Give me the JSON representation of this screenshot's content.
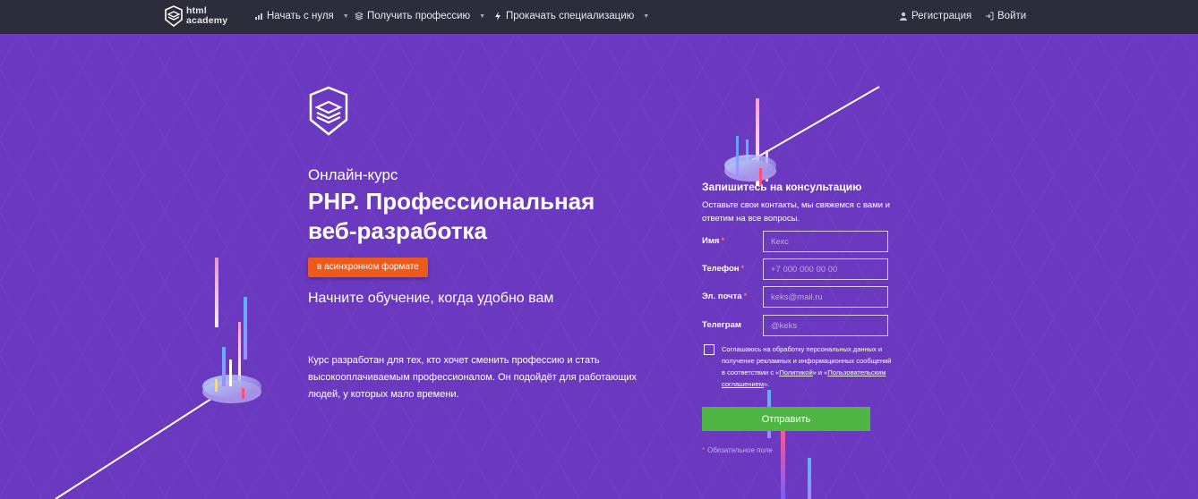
{
  "nav": {
    "logo_line1": "html",
    "logo_line2": "academy",
    "items": [
      {
        "label": "Начать с нуля",
        "icon": "bar-chart-icon"
      },
      {
        "label": "Получить профессию",
        "icon": "stack-icon"
      },
      {
        "label": "Прокачать специализацию",
        "icon": "lightning-icon"
      }
    ],
    "register": "Регистрация",
    "login": "Войти"
  },
  "hero": {
    "kicker": "Онлайн-курс",
    "title_line1": "PHP. Профессиональная",
    "title_line2": "веб-разработка",
    "format_badge": "в асинхронном формате",
    "tagline": "Начните обучение, когда удобно вам",
    "description": "Курс разработан для тех, кто хочет сменить профессию и стать высокооплачиваемым профессионалом. Он подойдёт для работающих людей, у которых мало времени."
  },
  "form": {
    "title": "Запишитесь на консультацию",
    "subtitle": "Оставьте свои контакты, мы свяжемся с вами и ответим на все вопросы.",
    "fields": [
      {
        "label": "Имя",
        "required": "*",
        "placeholder": "Кекс"
      },
      {
        "label": "Телефон",
        "required": "*",
        "placeholder": "+7 000 000 00 00"
      },
      {
        "label": "Эл. почта",
        "required": "*",
        "placeholder": "keks@mail.ru"
      },
      {
        "label": "Телеграм",
        "required": "",
        "placeholder": "@keks"
      }
    ],
    "consent": {
      "text1": "Соглашаюсь на обработку персональных данных и получение рекламных и информационных сообщений в соответствии с «",
      "link1": "Политикой",
      "text2": "» и «",
      "link2": "Пользовательским соглашением",
      "text3": "»."
    },
    "submit": "Отправить",
    "required_mark": "*",
    "required_note": "Обязательное поле"
  },
  "colors": {
    "background": "#6a39bf",
    "topbar": "#2d2c3a",
    "accent_orange": "#ee5a1c",
    "submit_green": "#4fb543"
  }
}
